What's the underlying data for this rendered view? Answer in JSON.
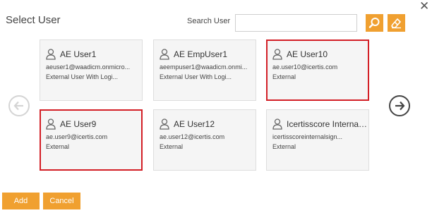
{
  "dialog": {
    "title": "Select User",
    "close_symbol": "✕"
  },
  "search": {
    "label": "Search User",
    "value": "",
    "placeholder": "",
    "search_icon": "magnifier-icon",
    "clear_icon": "eraser-icon"
  },
  "navigation": {
    "prev_icon": "arrow-left-circle-icon",
    "next_icon": "arrow-right-circle-icon"
  },
  "users": [
    {
      "name": "AE User1",
      "email": "aeuser1@waadicm.onmicro...",
      "type": "External User With Logi...",
      "selected": false
    },
    {
      "name": "AE EmpUser1",
      "email": "aeempuser1@waadicm.onmi...",
      "type": "External User With Logi...",
      "selected": false
    },
    {
      "name": "AE User10",
      "email": "ae.user10@icertis.com",
      "type": "External",
      "selected": true
    },
    {
      "name": "AE User9",
      "email": "ae.user9@icertis.com",
      "type": "External",
      "selected": true
    },
    {
      "name": "AE User12",
      "email": "ae.user12@icertis.com",
      "type": "External",
      "selected": false
    },
    {
      "name": "Icertisscore Internalsi...",
      "email": "icertisscoreinternalsign...",
      "type": "External",
      "selected": false
    }
  ],
  "footer": {
    "add_label": "Add",
    "cancel_label": "Cancel"
  },
  "colors": {
    "accent": "#f0a030",
    "selected_border": "#d31f26",
    "card_bg": "#f5f5f5"
  }
}
